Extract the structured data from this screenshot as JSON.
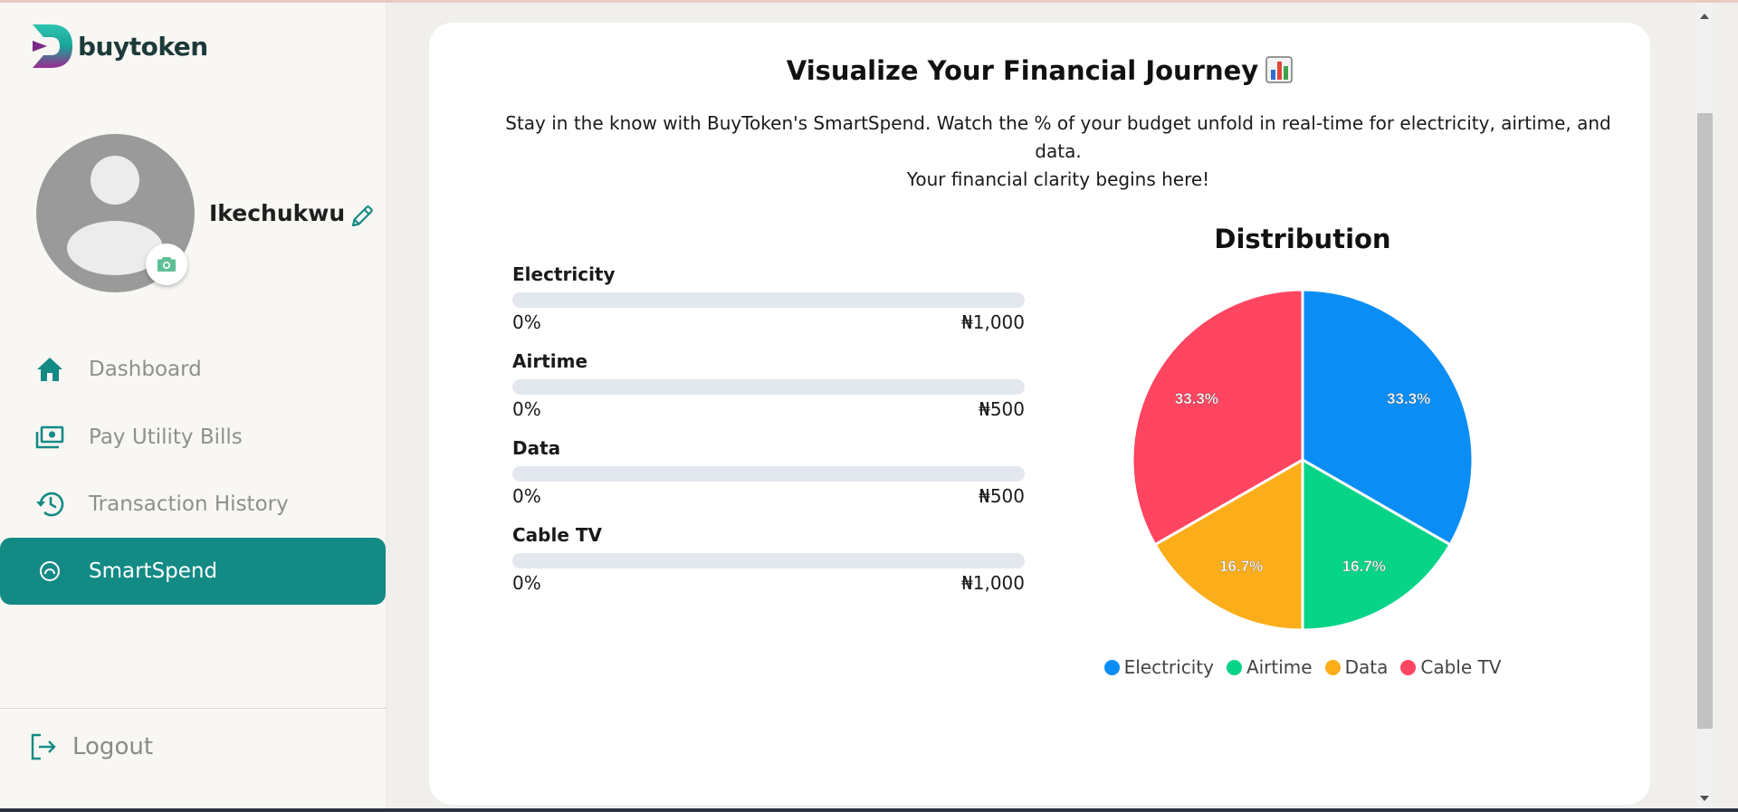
{
  "brand": {
    "name": "buytoken"
  },
  "profile": {
    "name": "Ikechukwu"
  },
  "nav": {
    "items": [
      {
        "label": "Dashboard",
        "icon": "home-icon"
      },
      {
        "label": "Pay Utility Bills",
        "icon": "money-icon"
      },
      {
        "label": "Transaction History",
        "icon": "history-icon"
      },
      {
        "label": "SmartSpend",
        "icon": "smartspend-icon",
        "active": true
      }
    ],
    "logout": "Logout"
  },
  "main": {
    "title": "Visualize Your Financial Journey",
    "description_line1": "Stay in the know with BuyToken's SmartSpend. Watch the % of your budget unfold in real-time for electricity, airtime, and data.",
    "description_line2": "Your financial clarity begins here!",
    "budgets": [
      {
        "name": "Electricity",
        "percent_label": "0%",
        "amount": "₦1,000",
        "progress": 0
      },
      {
        "name": "Airtime",
        "percent_label": "0%",
        "amount": "₦500",
        "progress": 0
      },
      {
        "name": "Data",
        "percent_label": "0%",
        "amount": "₦500",
        "progress": 0
      },
      {
        "name": "Cable TV",
        "percent_label": "0%",
        "amount": "₦1,000",
        "progress": 0
      }
    ]
  },
  "colors": {
    "accent": "#148a85",
    "electricity": "#0a8ef5",
    "airtime": "#08d488",
    "data": "#fbae1a",
    "cable_tv": "#ff4560"
  },
  "chart_data": {
    "type": "pie",
    "title": "Distribution",
    "categories": [
      "Electricity",
      "Airtime",
      "Data",
      "Cable TV"
    ],
    "values": [
      33.3,
      16.7,
      16.7,
      33.3
    ],
    "labels": [
      "33.3%",
      "16.7%",
      "16.7%",
      "33.3%"
    ],
    "colors": [
      "#0a8ef5",
      "#08d488",
      "#fbae1a",
      "#ff4560"
    ],
    "legend_position": "bottom"
  }
}
